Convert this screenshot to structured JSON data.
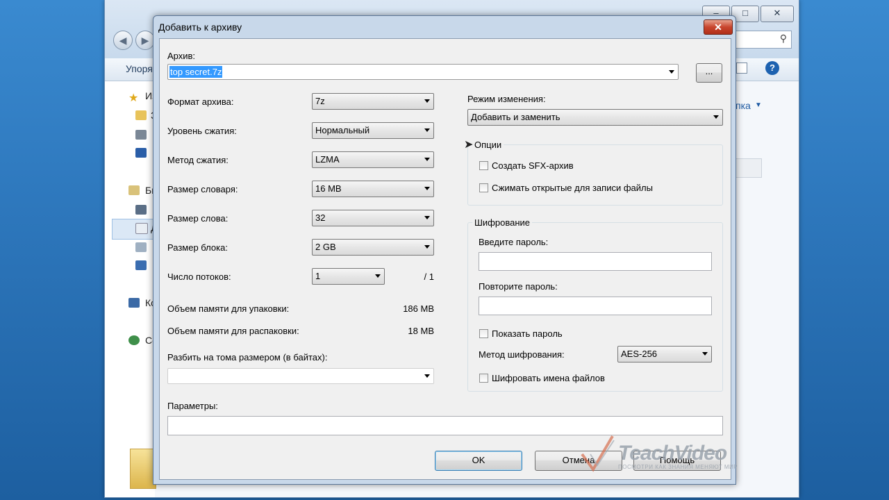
{
  "background_window": {
    "organize_label": "Упоря",
    "nav_items": [
      "Из",
      "З",
      "",
      "",
      "Би",
      "",
      "Д",
      "",
      "",
      "Ко",
      "Се"
    ],
    "right_link": "пка",
    "search_icon": "search-icon",
    "help_icon": "?"
  },
  "dialog": {
    "title": "Добавить к архиву",
    "close_label": "✕",
    "archive": {
      "label": "Архив:",
      "value": "top secret.7z",
      "browse_label": "..."
    },
    "left": {
      "format_label": "Формат архива:",
      "format_value": "7z",
      "level_label": "Уровень сжатия:",
      "level_value": "Нормальный",
      "method_label": "Метод сжатия:",
      "method_value": "LZMA",
      "dict_label": "Размер словаря:",
      "dict_value": "16 MB",
      "word_label": "Размер слова:",
      "word_value": "32",
      "block_label": "Размер блока:",
      "block_value": "2 GB",
      "threads_label": "Число потоков:",
      "threads_value": "1",
      "threads_total": "/ 1",
      "mem_pack_label": "Объем памяти для упаковки:",
      "mem_pack_value": "186 MB",
      "mem_unpack_label": "Объем памяти для распаковки:",
      "mem_unpack_value": "18 MB",
      "split_label": "Разбить на тома размером (в байтах):",
      "split_value": ""
    },
    "right": {
      "update_mode_label": "Режим изменения:",
      "update_mode_value": "Добавить и заменить",
      "options_title": "Опции",
      "sfx_label": "Создать SFX-архив",
      "sfx_checked": false,
      "shared_label": "Сжимать открытые для записи файлы",
      "shared_checked": false,
      "encryption_title": "Шифрование",
      "password_label": "Введите пароль:",
      "password_value": "",
      "repeat_label": "Повторите пароль:",
      "repeat_value": "",
      "show_password_label": "Показать пароль",
      "show_password_checked": false,
      "enc_method_label": "Метод шифрования:",
      "enc_method_value": "AES-256",
      "encrypt_names_label": "Шифровать имена файлов",
      "encrypt_names_checked": false
    },
    "params_label": "Параметры:",
    "params_value": "",
    "buttons": {
      "ok": "OK",
      "cancel": "Отмена",
      "help": "Помощь"
    }
  },
  "watermark": {
    "brand": "TeachVideo",
    "tagline": "ПОСМОТРИ КАК ЗНАНИЯ МЕНЯЮТ МИР"
  }
}
